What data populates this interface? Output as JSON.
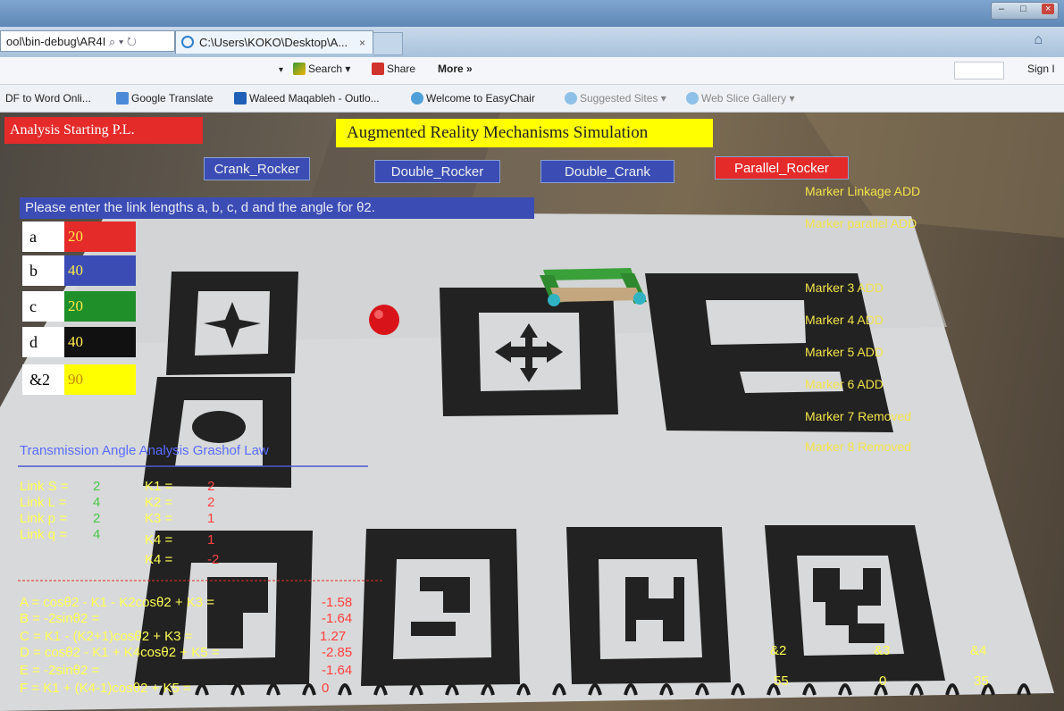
{
  "browser": {
    "address_text": "ool\\bin-debug\\AR4I",
    "tab_title": "C:\\Users\\KOKO\\Desktop\\A...",
    "tab_close": "×",
    "search_label": "Search",
    "share_label": "Share",
    "more_label": "More »",
    "sign_in_label": "Sign I",
    "favorites": [
      "DF to Word Onli...",
      "Google Translate",
      "Waleed Maqableh - Outlo...",
      "Welcome to EasyChair",
      "Suggested Sites ▾",
      "Web Slice Gallery ▾"
    ]
  },
  "app": {
    "status": "Analysis Starting  P.L.",
    "title": "Augmented Reality Mechanisms Simulation",
    "mechanisms": {
      "crank_rocker": "Crank_Rocker",
      "double_rocker": "Double_Rocker",
      "double_crank": "Double_Crank",
      "parallel_rocker": "Parallel_Rocker"
    },
    "prompt": "Please enter the link lengths a, b, c, d and the angle for θ2.",
    "inputs": [
      {
        "label": "a",
        "value": "20",
        "color": "#e52a2a",
        "text": "#ffe94a"
      },
      {
        "label": "b",
        "value": "40",
        "color": "#3b4db5",
        "text": "#ffe94a"
      },
      {
        "label": "c",
        "value": "20",
        "color": "#1f8f2a",
        "text": "#ffe94a"
      },
      {
        "label": "d",
        "value": "40",
        "color": "#111111",
        "text": "#ffe94a"
      },
      {
        "label": "&2",
        "value": "90",
        "color": "#ffff00",
        "text": "#c48a00"
      }
    ],
    "markers": [
      "Marker Linkage ADD",
      "Marker parallel ADD",
      "Marker 3 ADD",
      "Marker 4 ADD",
      "Marker 5 ADD",
      "Marker 6 ADD",
      "Marker 7 Removed",
      "Marker 8 Removed"
    ]
  },
  "analysis": {
    "heading": "Transmission Angle Analysis Grashof Law",
    "links": [
      {
        "label": "Link S =",
        "value": "2"
      },
      {
        "label": "Link L =",
        "value": "4"
      },
      {
        "label": "Link p =",
        "value": "2"
      },
      {
        "label": "Link q =",
        "value": "4"
      }
    ],
    "ks": [
      {
        "label": "K1 =",
        "value": "2"
      },
      {
        "label": "K2 =",
        "value": "2"
      },
      {
        "label": "K3 =",
        "value": "1"
      },
      {
        "label": "K4 =",
        "value": "1"
      },
      {
        "label": "K4 =",
        "value": "-2"
      }
    ],
    "equations": [
      {
        "label": "A = cosθ2 - K1 - K2cosθ2 + K3 =",
        "value": "-1.58"
      },
      {
        "label": "B = -2sinθ2 =",
        "value": "-1.64"
      },
      {
        "label": "C = K1 - (K2+1)cosθ2 + K3 =",
        "value": "1.27"
      },
      {
        "label": "D = cosθ2 - K1 + K4cosθ2 + K5 =",
        "value": "-2.85"
      },
      {
        "label": "E = -2sinθ2 =",
        "value": "-1.64"
      },
      {
        "label": "F = K1 + (K4-1)cosθ2 + K5 =",
        "value": "0"
      }
    ],
    "angles": [
      {
        "label": "&2",
        "value": "55"
      },
      {
        "label": "&3",
        "value": "0"
      },
      {
        "label": "&4",
        "value": "35"
      }
    ]
  }
}
